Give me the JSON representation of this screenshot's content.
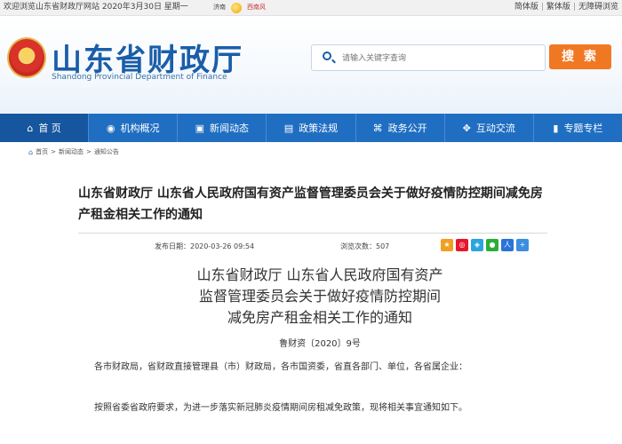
{
  "topbar": {
    "welcome": "欢迎浏览山东省财政厅网站  2020年3月30日 星期一",
    "weather_city": "济南",
    "weather_wind": "西南风",
    "links": [
      "简体版",
      "繁体版",
      "无障碍浏览"
    ]
  },
  "header": {
    "title": "山东省财政厅",
    "subtitle": "Shandong Provincial Department of Finance",
    "search_placeholder": "请输入关键字查询",
    "search_button": "搜 索"
  },
  "nav": {
    "items": [
      {
        "label": "首 页",
        "icon": "home-icon"
      },
      {
        "label": "机构概况",
        "icon": "location-icon"
      },
      {
        "label": "新闻动态",
        "icon": "news-icon"
      },
      {
        "label": "政策法规",
        "icon": "policy-icon"
      },
      {
        "label": "政务公开",
        "icon": "building-icon"
      },
      {
        "label": "互动交流",
        "icon": "handshake-icon"
      },
      {
        "label": "专题专栏",
        "icon": "book-icon"
      }
    ]
  },
  "breadcrumb": [
    "首页",
    "新闻动态",
    "通知公告"
  ],
  "article": {
    "title": "山东省财政厅 山东省人民政府国有资产监督管理委员会关于做好疫情防控期间减免房产租金相关工作的通知",
    "date_label": "发布日期：",
    "date": "2020-03-26 09:54",
    "views_label": "浏览次数：",
    "views": "507",
    "heading_lines": [
      "山东省财政厅 山东省人民政府国有资产",
      "监督管理委员会关于做好疫情防控期间",
      "减免房产租金相关工作的通知"
    ],
    "doc_number": "鲁财资〔2020〕9号",
    "paragraphs": [
      "各市财政局，省财政直接管理县（市）财政局，各市国资委，省直各部门、单位，各省属企业：",
      "按照省委省政府要求，为进一步落实新冠肺炎疫情期间房租减免政策，现将相关事宜通知如下。"
    ]
  },
  "colors": {
    "brand_blue": "#1f6ec2",
    "search_orange": "#f07823"
  }
}
